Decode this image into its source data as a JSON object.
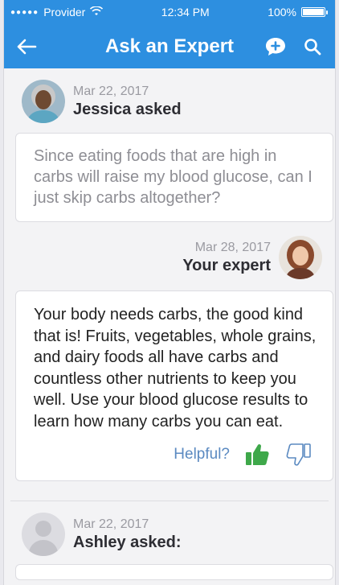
{
  "status_bar": {
    "carrier": "Provider",
    "time": "12:34 PM",
    "battery": "100%"
  },
  "nav": {
    "title": "Ask an Expert"
  },
  "question": {
    "date": "Mar 22, 2017",
    "author": "Jessica asked",
    "text": "Since eating foods that are high in carbs will raise my blood glucose, can I just skip carbs altogether?"
  },
  "answer": {
    "date": "Mar 28, 2017",
    "author": "Your expert",
    "text": "Your body needs carbs, the good kind that is! Fruits, vegetables, whole grains, and dairy foods all have carbs and countless other nutrients to keep you well. Use your blood glucose results to learn how many carbs you can eat.",
    "helpful_label": "Helpful?"
  },
  "next_question": {
    "date": "Mar 22, 2017",
    "author": "Ashley asked:"
  },
  "colors": {
    "primary": "#2d8fe0",
    "thumbs_up": "#3ea84a",
    "thumbs_down": "#5b8ac1"
  }
}
